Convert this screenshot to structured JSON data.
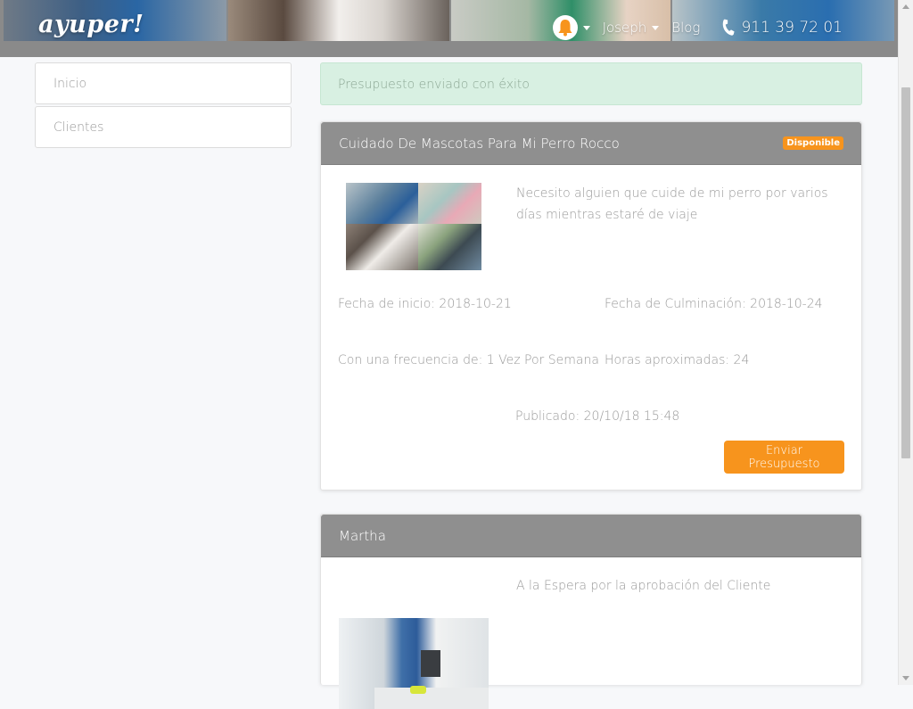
{
  "header": {
    "logo": "ayuper!",
    "user_name": "Joseph",
    "blog_label": "Blog",
    "phone": "911 39 72 01"
  },
  "sidebar": {
    "items": [
      {
        "label": "Inicio"
      },
      {
        "label": "Clientes"
      }
    ]
  },
  "alert": {
    "message": "Presupuesto enviado con éxito"
  },
  "job": {
    "title": "Cuidado De Mascotas Para Mi Perro Rocco",
    "status_badge": "Disponible",
    "description": "Necesito alguien que cuide de mi perro por varios días mientras estaré de viaje",
    "start_date": "Fecha de inicio: 2018-10-21",
    "end_date": "Fecha de Culminación: 2018-10-24",
    "frequency": "Con una frecuencia de: 1 Vez Por Semana",
    "hours": "Horas aproximadas: 24",
    "published": "Publicado: 20/10/18 15:48",
    "send_button": "Enviar Presupuesto"
  },
  "worker": {
    "name": "Martha",
    "status_text": "A la Espera por la aprobación del Cliente"
  },
  "colors": {
    "accent": "#f7941d",
    "card_header": "#8f8f8f",
    "success_bg": "#d8f0e2"
  }
}
